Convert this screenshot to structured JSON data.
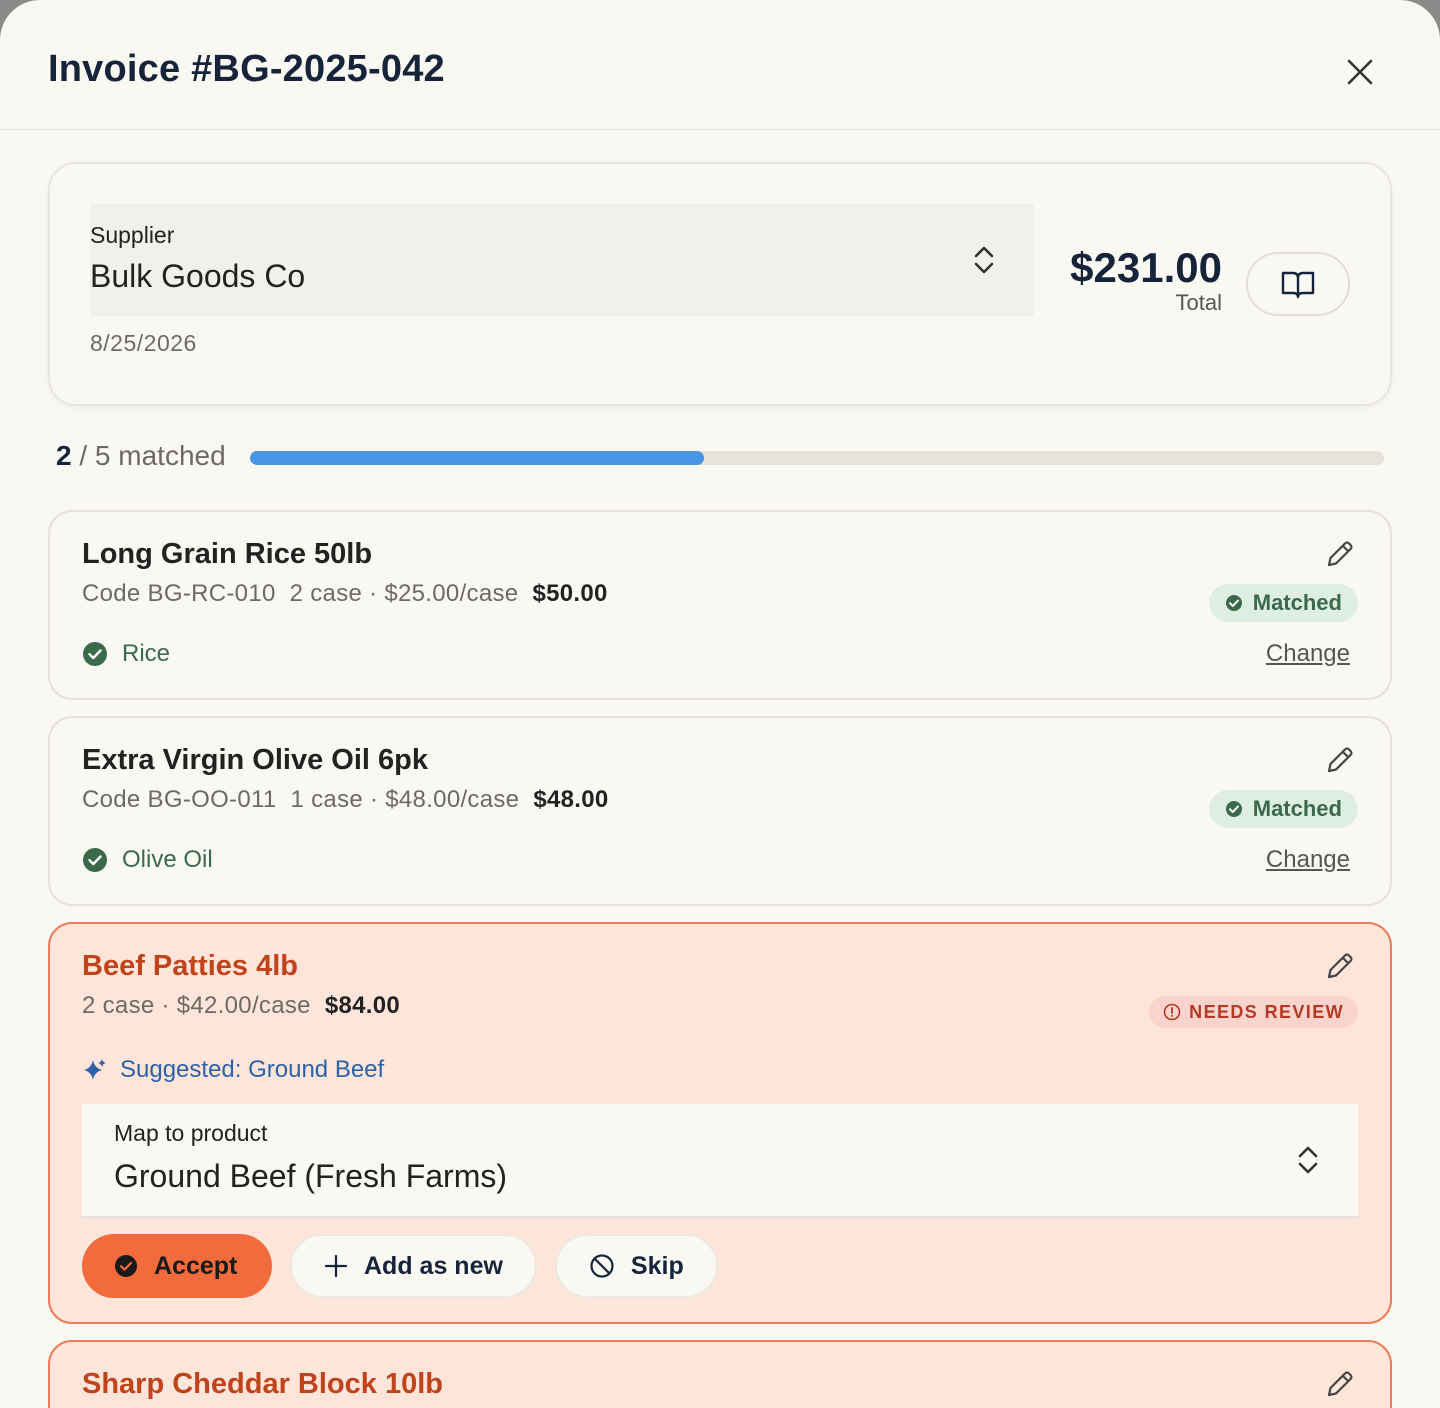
{
  "header": {
    "title": "Invoice #BG-2025-042"
  },
  "supplier": {
    "label": "Supplier",
    "value": "Bulk Goods Co",
    "date": "8/25/2026",
    "total": "$231.00",
    "total_label": "Total"
  },
  "progress": {
    "matched": "2",
    "rest": " / 5 matched",
    "fraction": 0.4
  },
  "items": [
    {
      "name": "Long Grain Rice 50lb",
      "code": "Code BG-RC-010",
      "qty": "2 case · $25.00/case",
      "amount": "$50.00",
      "status": "Matched",
      "product": "Rice",
      "change": "Change"
    },
    {
      "name": "Extra Virgin Olive Oil 6pk",
      "code": "Code BG-OO-011",
      "qty": "1 case · $48.00/case",
      "amount": "$48.00",
      "status": "Matched",
      "product": "Olive Oil",
      "change": "Change"
    },
    {
      "name": "Beef Patties 4lb",
      "qty": "2 case · $42.00/case",
      "amount": "$84.00",
      "status": "NEEDS REVIEW",
      "suggestion": "Suggested: Ground Beef",
      "map_label": "Map to product",
      "map_value": "Ground Beef (Fresh Farms)",
      "accept": "Accept",
      "add_new": "Add as new",
      "skip": "Skip"
    },
    {
      "name": "Sharp Cheddar Block 10lb"
    }
  ],
  "colors": {
    "accent": "#f26b3c",
    "progress": "#4a94e6",
    "matched": "#3b6a4a",
    "review": "#c0431c"
  }
}
